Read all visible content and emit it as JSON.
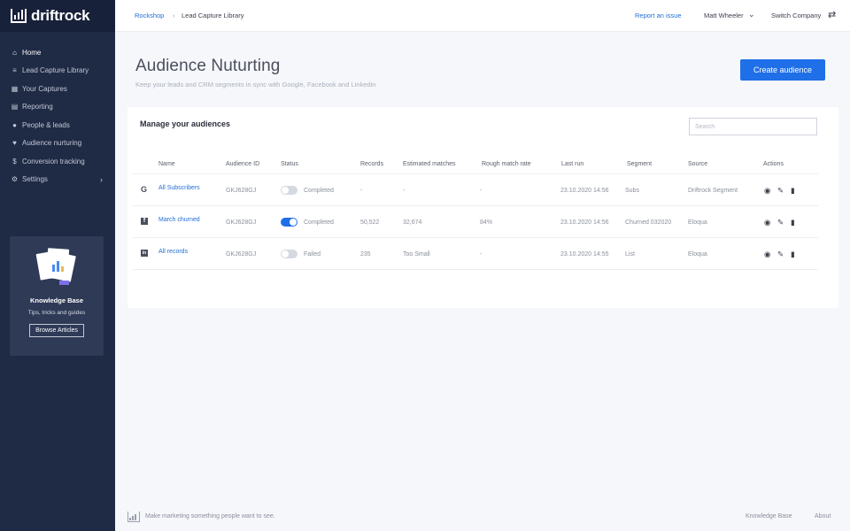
{
  "brand": {
    "name": "driftrock"
  },
  "sidebar": {
    "items": [
      {
        "label": "Home",
        "icon": "home-icon",
        "glyph": "⌂",
        "active": true
      },
      {
        "label": "Lead Capture Library",
        "icon": "filter-icon",
        "glyph": "≡"
      },
      {
        "label": "Your Captures",
        "icon": "grid-icon",
        "glyph": "▦"
      },
      {
        "label": "Reporting",
        "icon": "chart-icon",
        "glyph": "▤"
      },
      {
        "label": "People & leads",
        "icon": "people-icon",
        "glyph": "👥"
      },
      {
        "label": "Audience nurturing",
        "icon": "heart-icon",
        "glyph": "♥"
      },
      {
        "label": "Conversion tracking",
        "icon": "dollar-icon",
        "glyph": "$"
      },
      {
        "label": "Settings",
        "icon": "gear-icon",
        "glyph": "⚙"
      }
    ],
    "knowledge_base": {
      "title": "Knowledge Base",
      "subtitle": "Tips, tricks and guides",
      "button": "Browse Articles"
    }
  },
  "topbar": {
    "breadcrumb": [
      "Rockshop",
      "Lead Capture Library"
    ],
    "breadcrumb_sep": "›",
    "report_link": "Report an issue",
    "user": "Matt Wheeler",
    "switch_company": "Switch Company"
  },
  "header": {
    "title": "Audience Nuturting",
    "subtitle": "Keep your leads and CRM segments in sync with Google, Facebook and Linkedin",
    "create_button": "Create audience"
  },
  "card": {
    "title": "Manage your audiences",
    "search_placeholder": "Search",
    "columns": [
      "Name",
      "Audience ID",
      "Status",
      "Records",
      "Estimated matches",
      "Rough match rate",
      "Last run",
      "Segment",
      "Source",
      "Actions"
    ],
    "rows": [
      {
        "platform_icon": "google-icon",
        "glyph": "G",
        "name": "All Subscribers",
        "audience_id": "GKJ628GJ",
        "status_on": false,
        "status": "Completed",
        "records": "-",
        "estimated_matches": "-",
        "rough_match_rate": "-",
        "last_run": "23.10.2020 14:56",
        "segment": "Subs",
        "source": "Driftrock Segment"
      },
      {
        "platform_icon": "facebook-icon",
        "glyph": "f",
        "name": "March churned",
        "audience_id": "GKJ628GJ",
        "status_on": true,
        "status": "Completed",
        "records": "50,522",
        "estimated_matches": "32,674",
        "rough_match_rate": "84%",
        "last_run": "23.10.2020 14:56",
        "segment": "Churned 032020",
        "source": "Eloqua"
      },
      {
        "platform_icon": "linkedin-icon",
        "glyph": "in",
        "name": "All records",
        "audience_id": "GKJ628GJ",
        "status_on": false,
        "status": "Failed",
        "records": "235",
        "estimated_matches": "Too Small",
        "rough_match_rate": "-",
        "last_run": "23.10.2020 14:55",
        "segment": "List",
        "source": "Eloqua"
      }
    ]
  },
  "footer": {
    "tagline": "Make marketing something people want to see.",
    "links": [
      "Knowledge Base",
      "About"
    ]
  },
  "colors": {
    "sidebar": "#1f2a44",
    "accent": "#1f6fe8",
    "link": "#1f6fd6"
  }
}
